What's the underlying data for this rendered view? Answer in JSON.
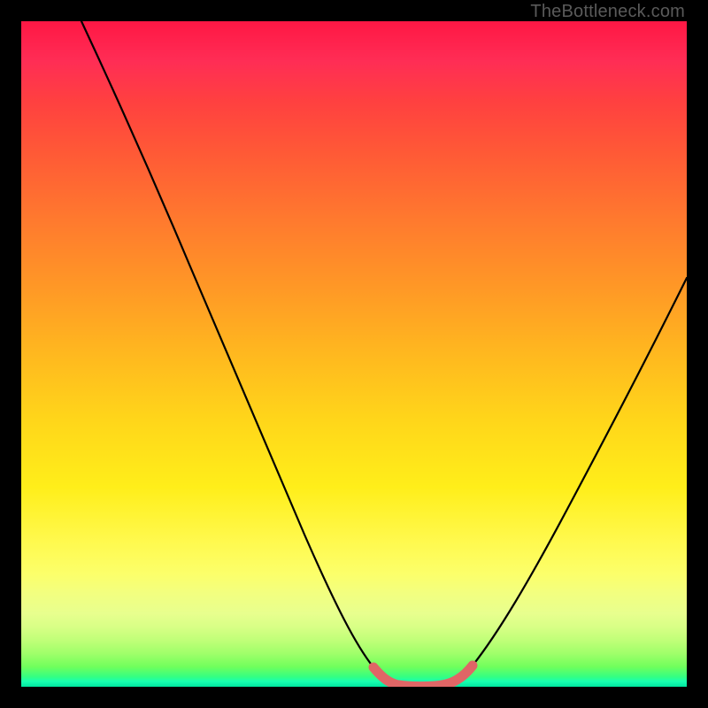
{
  "attribution": "TheBottleneck.com",
  "colors": {
    "frame": "#000000",
    "curve_stroke": "#000000",
    "highlight_stroke": "#e06666",
    "gradient_top": "#ff1744",
    "gradient_bottom": "#00e59e"
  },
  "chart_data": {
    "type": "line",
    "title": "",
    "xlabel": "",
    "ylabel": "",
    "xlim": [
      0,
      100
    ],
    "ylim": [
      0,
      100
    ],
    "grid": false,
    "series": [
      {
        "name": "bottleneck-curve",
        "description": "V-shaped curve; y=0 is optimal (green), y=100 is worst (red). Minimum (flat bottom) around x≈56-66.",
        "x": [
          9,
          15,
          20,
          25,
          30,
          35,
          40,
          45,
          50,
          53,
          56,
          58,
          60,
          62,
          64,
          66,
          68,
          72,
          78,
          84,
          90,
          96,
          100
        ],
        "y": [
          100,
          88,
          78,
          68,
          58,
          48,
          38,
          28,
          17,
          9,
          2,
          0,
          0,
          0,
          0,
          1,
          4,
          11,
          22,
          33,
          44,
          55,
          62
        ]
      }
    ],
    "annotations": [
      {
        "type": "highlight-segment",
        "description": "Thick coral highlight on the flat bottom of the curve",
        "x_start": 53,
        "x_end": 68,
        "color": "#e06666"
      }
    ]
  }
}
